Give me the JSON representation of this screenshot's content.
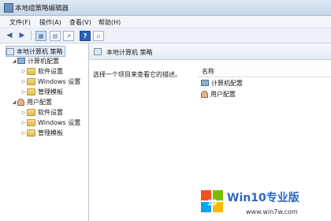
{
  "window": {
    "title": "本地组策略编辑器"
  },
  "menu": {
    "items": [
      "文件(F)",
      "操作(A)",
      "查看(V)",
      "帮助(H)"
    ]
  },
  "toolbar": {
    "help_label": "?"
  },
  "tree": {
    "root": "本地计算机 策略",
    "computer": {
      "label": "计算机配置",
      "children": [
        "软件设置",
        "Windows 设置",
        "管理模板"
      ]
    },
    "user": {
      "label": "用户配置",
      "children": [
        "软件设置",
        "Windows 设置",
        "管理模板"
      ]
    }
  },
  "details": {
    "header": "本地计算机 策略",
    "description": "选择一个项目来查看它的描述。",
    "column_name": "名称",
    "items": [
      "计算机配置",
      "用户配置"
    ]
  },
  "watermark": {
    "logo_text": "10",
    "title": "Win10专业版",
    "url": "www.win7w.com"
  }
}
